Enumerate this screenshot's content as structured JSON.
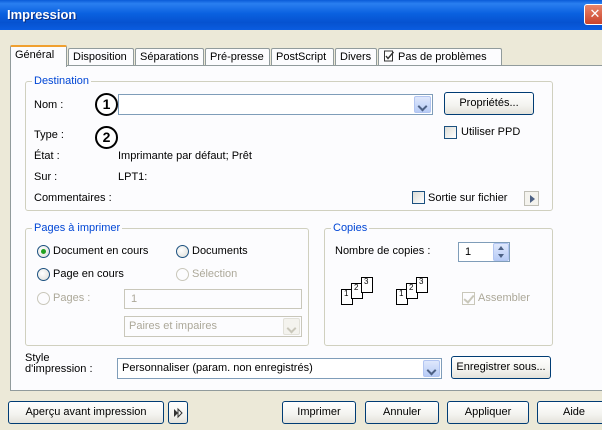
{
  "window": {
    "title": "Impression"
  },
  "tabs": [
    {
      "label": "Général",
      "active": true
    },
    {
      "label": "Disposition"
    },
    {
      "label": "Séparations"
    },
    {
      "label": "Pré-presse"
    },
    {
      "label": "PostScript"
    },
    {
      "label": "Divers"
    },
    {
      "label": "Pas de problèmes",
      "icon": "checklist-icon"
    }
  ],
  "destination": {
    "legend": "Destination",
    "name_label": "Nom :",
    "name_value": "",
    "badge_1": "1",
    "badge_2": "2",
    "properties_button": "Propriétés...",
    "type_label": "Type :",
    "use_ppd_label": "Utiliser PPD",
    "state_label": "État :",
    "state_value": "Imprimante par défaut; Prêt",
    "on_label": "Sur :",
    "on_value": "LPT1:",
    "comments_label": "Commentaires :",
    "print_to_file_label": "Sortie sur fichier"
  },
  "pages": {
    "legend": "Pages à imprimer",
    "current_document": "Document en cours",
    "documents": "Documents",
    "current_page": "Page en cours",
    "selection": "Sélection",
    "pages_label": "Pages :",
    "pages_value": "1",
    "odd_even_value": "Paires et impaires"
  },
  "copies": {
    "legend": "Copies",
    "count_label": "Nombre de copies :",
    "count_value": "1",
    "collate_label": "Assembler",
    "collate_pages": [
      "1",
      "2",
      "3"
    ]
  },
  "style": {
    "label_line1": "Style",
    "label_line2": "d'impression :",
    "value": "Personnaliser (param. non enregistrés)",
    "save_as_button": "Enregistrer sous..."
  },
  "footer": {
    "preview_button": "Aperçu avant impression",
    "print_button": "Imprimer",
    "cancel_button": "Annuler",
    "apply_button": "Appliquer",
    "help_button": "Aide"
  },
  "colors": {
    "titlebar": "#0a61e0",
    "group_legend": "#0046d5",
    "radio_dot": "#21a121"
  }
}
